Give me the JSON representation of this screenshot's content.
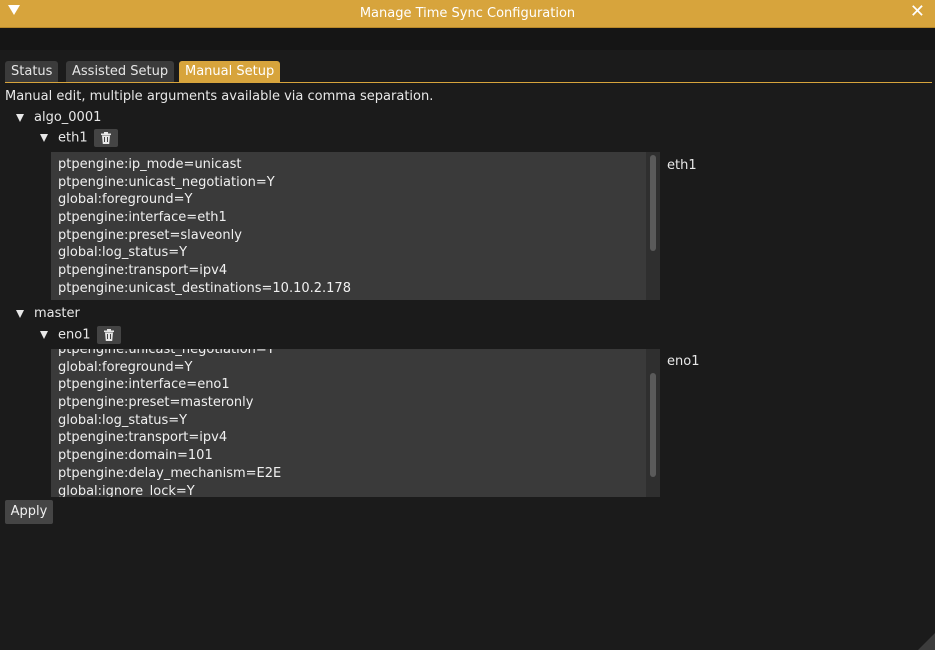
{
  "window": {
    "title": "Manage Time Sync Configuration",
    "close_glyph": "✕"
  },
  "tabs": [
    {
      "label": "Status",
      "active": false
    },
    {
      "label": "Assisted Setup",
      "active": false
    },
    {
      "label": "Manual Setup",
      "active": true
    }
  ],
  "hint": "Manual edit, multiple arguments available via comma separation.",
  "groups": [
    {
      "name": "algo_0001",
      "interface": "eth1",
      "side_label": "eth1",
      "lines": [
        "ptpengine:ip_mode=unicast",
        "ptpengine:unicast_negotiation=Y",
        "global:foreground=Y",
        "ptpengine:interface=eth1",
        "ptpengine:preset=slaveonly",
        "global:log_status=Y",
        "ptpengine:transport=ipv4",
        "ptpengine:unicast_destinations=10.10.2.178"
      ]
    },
    {
      "name": "master",
      "interface": "eno1",
      "side_label": "eno1",
      "lines": [
        "ptpengine:unicast_negotiation=Y",
        "global:foreground=Y",
        "ptpengine:interface=eno1",
        "ptpengine:preset=masteronly",
        "global:log_status=Y",
        "ptpengine:transport=ipv4",
        "ptpengine:domain=101",
        "ptpengine:delay_mechanism=E2E",
        "global:ignore_lock=Y"
      ]
    }
  ],
  "apply_label": "Apply",
  "colors": {
    "accent": "#d7a43c",
    "background": "#1b1b1b",
    "field": "#3a3a3a"
  },
  "icons": {
    "delete": "trash-icon",
    "collapse": "collapse-arrow-icon",
    "close": "close-icon"
  }
}
